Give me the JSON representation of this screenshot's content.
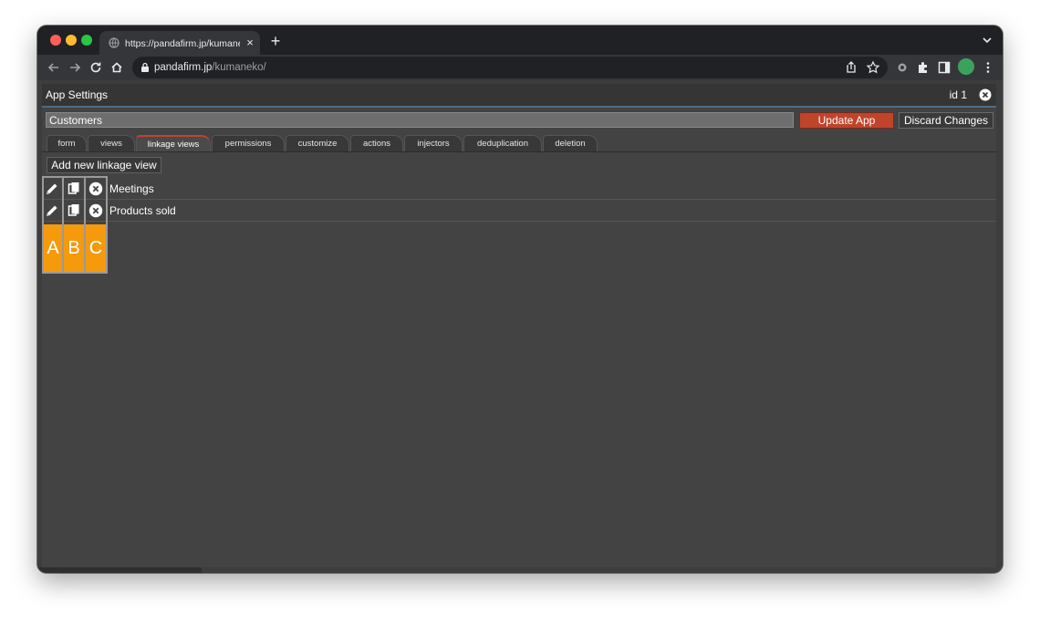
{
  "browser": {
    "tab_title": "https://pandafirm.jp/kumaneko/",
    "tab_close": "×",
    "new_tab": "+",
    "url_host": "pandafirm.jp",
    "url_path": "/kumaneko/"
  },
  "modal": {
    "title": "App Settings",
    "id_label": "id 1",
    "name_value": "Customers",
    "update_button": "Update App",
    "discard_button": "Discard Changes"
  },
  "tabs": [
    {
      "label": "form"
    },
    {
      "label": "views"
    },
    {
      "label": "linkage views",
      "active": true
    },
    {
      "label": "permissions"
    },
    {
      "label": "customize"
    },
    {
      "label": "actions"
    },
    {
      "label": "injectors"
    },
    {
      "label": "deduplication"
    },
    {
      "label": "deletion"
    }
  ],
  "add_button": "Add new linkage view",
  "linkage_views": [
    {
      "label": "Meetings"
    },
    {
      "label": "Products sold"
    }
  ],
  "markers": [
    "A",
    "B",
    "C"
  ],
  "colors": {
    "accent": "#c0442a",
    "marker": "#f59a0c",
    "background": "#434343"
  },
  "icons": {
    "row": [
      "pencil-icon",
      "copy-icon",
      "delete-circle-icon"
    ]
  }
}
